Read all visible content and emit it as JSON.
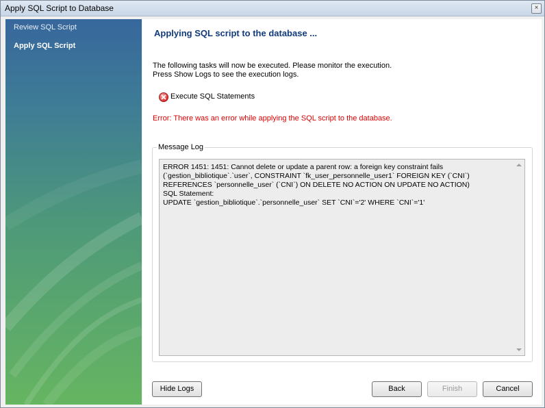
{
  "window": {
    "title": "Apply SQL Script to Database",
    "close_glyph": "×"
  },
  "sidebar": {
    "items": [
      {
        "label": "Review SQL Script",
        "active": false
      },
      {
        "label": "Apply SQL Script",
        "active": true
      }
    ]
  },
  "main": {
    "title": "Applying SQL script to the database ...",
    "description_line1": "The following tasks will now be executed. Please monitor the execution.",
    "description_line2": "Press Show Logs to see the execution logs.",
    "task": {
      "label": "Execute SQL Statements",
      "status_icon": "error-icon"
    },
    "error_message": "Error: There was an error while applying the SQL script to the database.",
    "log": {
      "legend": "Message Log",
      "text": "ERROR 1451: 1451: Cannot delete or update a parent row: a foreign key constraint fails\n(`gestion_bibliotique`.`user`, CONSTRAINT `fk_user_personnelle_user1` FOREIGN KEY (`CNI`)\nREFERENCES `personnelle_user` (`CNI`) ON DELETE NO ACTION ON UPDATE NO ACTION)\nSQL Statement:\nUPDATE `gestion_bibliotique`.`personnelle_user` SET `CNI`='2' WHERE `CNI`='1'"
    }
  },
  "buttons": {
    "hide_logs": "Hide Logs",
    "back": "Back",
    "finish": "Finish",
    "cancel": "Cancel"
  },
  "colors": {
    "title_blue": "#123a7a",
    "error_red": "#d60000",
    "sidebar_top": "#37679c",
    "sidebar_bottom": "#66b561"
  }
}
